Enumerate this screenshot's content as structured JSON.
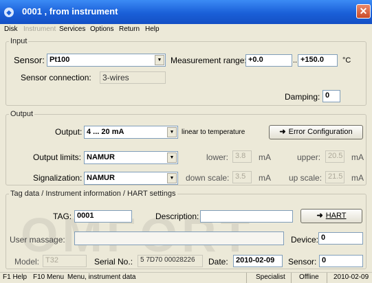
{
  "window": {
    "title": "0001     , from instrument",
    "close_glyph": "✕"
  },
  "menu": [
    "Disk",
    "Instrument",
    "Services",
    "Options",
    "Return",
    "Help"
  ],
  "input": {
    "legend": "Input",
    "sensor_label": "Sensor:",
    "sensor_value": "Pt100",
    "range_label": "Measurement range:",
    "range_low": "+0.0",
    "range_dots": "...",
    "range_high": "+150.0",
    "range_unit": "°C",
    "connection_label": "Sensor connection:",
    "connection_value": "3-wires",
    "damping_label": "Damping:",
    "damping_value": "0"
  },
  "output": {
    "legend": "Output",
    "output_label": "Output:",
    "output_value": "4 ... 20 mA",
    "linear_text": "linear to temperature",
    "error_button": "Error Configuration",
    "limits_label": "Output limits:",
    "limits_value": "NAMUR",
    "lower_label": "lower:",
    "lower_value": "3.8",
    "lower_unit": "mA",
    "upper_label": "upper:",
    "upper_value": "20.5",
    "upper_unit": "mA",
    "signal_label": "Signalization:",
    "signal_value": "NAMUR",
    "down_label": "down scale:",
    "down_value": "3.5",
    "down_unit": "mA",
    "up_label": "up scale:",
    "up_value": "21.5",
    "up_unit": "mA"
  },
  "tag": {
    "legend": "Tag data / Instrument information / HART settings",
    "tag_label": "TAG:",
    "tag_value": "0001",
    "description_label": "Description:",
    "description_value": "",
    "hart_button": "HART",
    "user_label": "User massage:",
    "user_value": "",
    "device_label": "Device:",
    "device_value": "0",
    "model_label": "Model:",
    "model_value": "T32",
    "serial_label": "Serial No.:",
    "serial_value": "5 7D70 00028226",
    "date_label": "Date:",
    "date_value": "2010-02-09",
    "sensor_label": "Sensor:",
    "sensor_value": "0"
  },
  "status": {
    "help": "F1 Help",
    "menu": "F10 Menu",
    "info": "Menu, instrument data",
    "role": "Specialist",
    "mode": "Offline",
    "date": "2010-02-09"
  },
  "watermark": "OMFORT",
  "colors": {
    "title_bar": "#1a5fd8",
    "dialog_bg": "#ece9d8",
    "close_button": "#c94a27"
  }
}
